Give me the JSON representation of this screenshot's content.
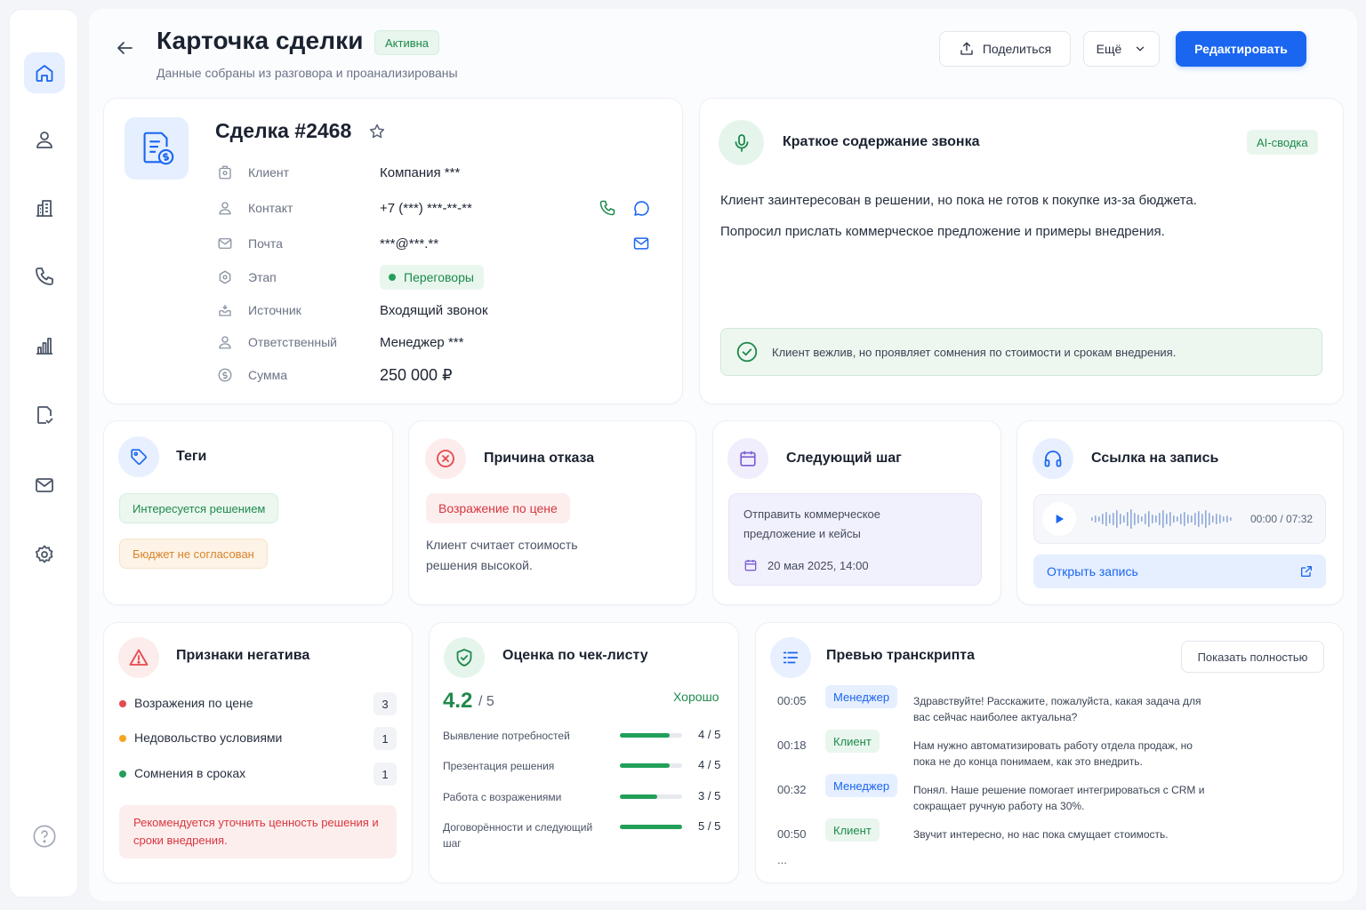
{
  "header": {
    "title": "Карточка сделки",
    "status": "Активна",
    "subtitle": "Данные собраны из разговора и проанализированы",
    "share_label": "Поделиться",
    "more_label": "Ещё",
    "edit_label": "Редактировать"
  },
  "sidebar": {
    "items": [
      {
        "icon": "home-icon",
        "active": true
      },
      {
        "icon": "user-icon"
      },
      {
        "icon": "building-icon"
      },
      {
        "icon": "phone-icon"
      },
      {
        "icon": "chart-icon"
      },
      {
        "icon": "document-check-icon"
      },
      {
        "icon": "mail-icon"
      },
      {
        "icon": "gear-icon"
      }
    ],
    "help_icon": "help-icon"
  },
  "deal": {
    "title": "Сделка #2468",
    "fields": {
      "client": {
        "label": "Клиент",
        "value": "Компания ***"
      },
      "contact": {
        "label": "Контакт",
        "value": "+7 (***) ***-**-**"
      },
      "email": {
        "label": "Почта",
        "value": "***@***.**"
      },
      "stage": {
        "label": "Этап",
        "value": "Переговоры"
      },
      "source": {
        "label": "Источник",
        "value": "Входящий звонок"
      },
      "owner": {
        "label": "Ответственный",
        "value": "Менеджер ***"
      },
      "amount": {
        "label": "Сумма",
        "value": "250 000 ₽"
      }
    }
  },
  "summary": {
    "title": "Краткое содержание звонка",
    "badge": "AI-сводка",
    "lines": [
      "Клиент заинтересован в решении, но пока не готов к покупке из-за бюджета.",
      "Попросил прислать коммерческое предложение и примеры внедрения."
    ],
    "insight": "Клиент вежлив, но проявляет сомнения по стоимости и срокам внедрения."
  },
  "tags": {
    "title": "Теги",
    "items": [
      "Интересуется решением",
      "Бюджет не согласован"
    ]
  },
  "refusal": {
    "title": "Причина отказа",
    "chip": "Возражение по цене",
    "text": "Клиент считает стоимость решения высокой."
  },
  "next_step": {
    "title": "Следующий шаг",
    "text": "Отправить коммерческое предложение и кейсы",
    "date": "20 мая 2025, 14:00"
  },
  "recording": {
    "title": "Ссылка на запись",
    "time": "00:00 / 07:32",
    "progress": 0,
    "open_label": "Открыть запись"
  },
  "negative": {
    "title": "Признаки негатива",
    "items": [
      {
        "label": "Возражения по цене",
        "count": "3",
        "color": "#e5484d"
      },
      {
        "label": "Недовольство условиями",
        "count": "1",
        "color": "#f5a623"
      },
      {
        "label": "Сомнения в сроках",
        "count": "1",
        "color": "#22a05a"
      }
    ],
    "recommendation": "Рекомендуется уточнить ценность решения и сроки внедрения."
  },
  "checklist": {
    "title": "Оценка по чек-листу",
    "score": "4.2",
    "score_of": "/ 5",
    "rating": "Хорошо",
    "items": [
      {
        "label": "Выявление потребностей",
        "score": "4 / 5",
        "value": 4
      },
      {
        "label": "Презентация решения",
        "score": "4 / 5",
        "value": 4
      },
      {
        "label": "Работа с возражениями",
        "score": "3 / 5",
        "value": 3
      },
      {
        "label": "Договорённости и следующий шаг",
        "score": "5 / 5",
        "value": 5
      }
    ]
  },
  "transcript": {
    "title": "Превью транскрипта",
    "show_all_label": "Показать полностью",
    "rows": [
      {
        "time": "00:05",
        "speaker": "Менеджер",
        "role": "manager",
        "text": "Здравствуйте!  Расскажите, пожалуйста, какая задача для вас сейчас наиболее актуальна?"
      },
      {
        "time": "00:18",
        "speaker": "Клиент",
        "role": "client",
        "text": "Нам нужно автоматизировать работу отдела продаж, но пока не до конца понимаем, как это внедрить."
      },
      {
        "time": "00:32",
        "speaker": "Менеджер",
        "role": "manager",
        "text": "Понял. Наше решение помогает интегрироваться с CRM и сокращает ручную работу на 30%."
      },
      {
        "time": "00:50",
        "speaker": "Клиент",
        "role": "client",
        "text": "Звучит интересно, но нас пока смущает стоимость."
      }
    ],
    "ellipsis": "..."
  },
  "colors": {
    "accent": "#1a66f0",
    "success": "#1f8a4c",
    "danger": "#d7373f",
    "warning": "#d9822b"
  }
}
